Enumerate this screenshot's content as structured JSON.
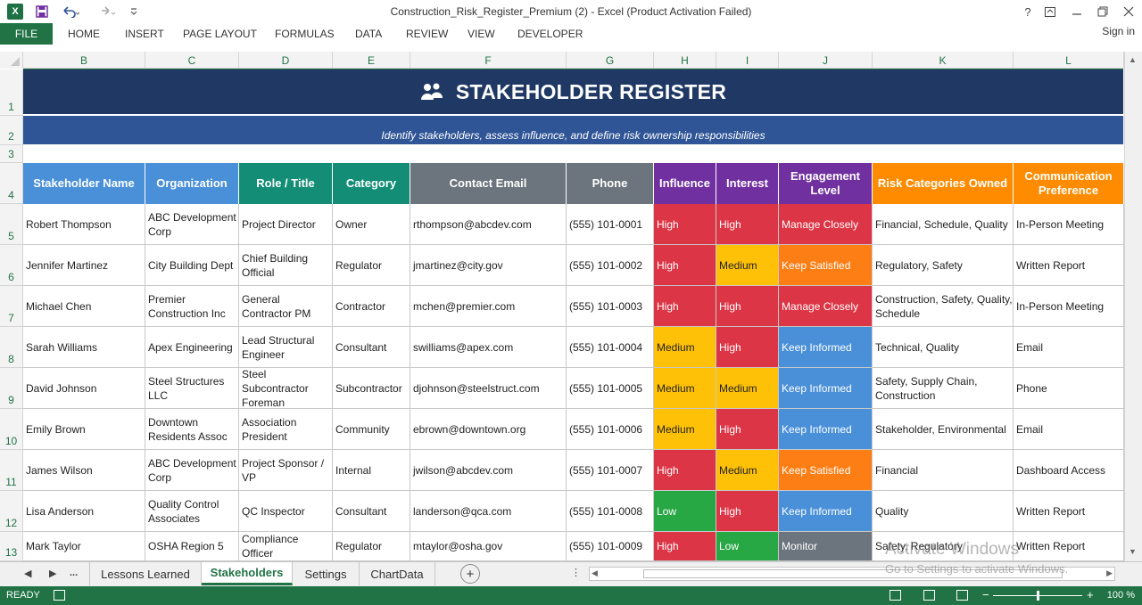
{
  "window": {
    "title": "Construction_Risk_Register_Premium (2) - Excel (Product Activation Failed)",
    "help": "?",
    "sign_in": "Sign in"
  },
  "ribbon": {
    "file": "FILE",
    "tabs": [
      "HOME",
      "INSERT",
      "PAGE LAYOUT",
      "FORMULAS",
      "DATA",
      "REVIEW",
      "VIEW",
      "DEVELOPER"
    ]
  },
  "columns": [
    "B",
    "C",
    "D",
    "E",
    "F",
    "G",
    "H",
    "I",
    "J",
    "K",
    "L"
  ],
  "rows": [
    "1",
    "2",
    "3",
    "4",
    "5",
    "6",
    "7",
    "8",
    "9",
    "10",
    "11",
    "12",
    "13"
  ],
  "banner": {
    "title": "STAKEHOLDER REGISTER",
    "subtitle": "Identify stakeholders, assess influence, and define risk ownership responsibilities"
  },
  "table": {
    "headers": [
      "Stakeholder Name",
      "Organization",
      "Role / Title",
      "Category",
      "Contact Email",
      "Phone",
      "Influence",
      "Interest",
      "Engagement Level",
      "Risk Categories Owned",
      "Communication Preference"
    ],
    "rows": [
      [
        "Robert Thompson",
        "ABC Development Corp",
        "Project Director",
        "Owner",
        "rthompson@abcdev.com",
        "(555) 101-0001",
        "High",
        "High",
        "Manage Closely",
        "Financial, Schedule, Quality",
        "In-Person Meeting"
      ],
      [
        "Jennifer Martinez",
        "City Building Dept",
        "Chief Building Official",
        "Regulator",
        "jmartinez@city.gov",
        "(555) 101-0002",
        "High",
        "Medium",
        "Keep Satisfied",
        "Regulatory, Safety",
        "Written Report"
      ],
      [
        "Michael Chen",
        "Premier Construction Inc",
        "General Contractor PM",
        "Contractor",
        "mchen@premier.com",
        "(555) 101-0003",
        "High",
        "High",
        "Manage Closely",
        "Construction, Safety, Quality, Schedule",
        "In-Person Meeting"
      ],
      [
        "Sarah Williams",
        "Apex Engineering",
        "Lead Structural Engineer",
        "Consultant",
        "swilliams@apex.com",
        "(555) 101-0004",
        "Medium",
        "High",
        "Keep Informed",
        "Technical, Quality",
        "Email"
      ],
      [
        "David Johnson",
        "Steel Structures LLC",
        "Steel Subcontractor Foreman",
        "Subcontractor",
        "djohnson@steelstruct.com",
        "(555) 101-0005",
        "Medium",
        "Medium",
        "Keep Informed",
        "Safety, Supply Chain, Construction",
        "Phone"
      ],
      [
        "Emily Brown",
        "Downtown Residents Assoc",
        "Association President",
        "Community",
        "ebrown@downtown.org",
        "(555) 101-0006",
        "Medium",
        "High",
        "Keep Informed",
        "Stakeholder, Environmental",
        "Email"
      ],
      [
        "James Wilson",
        "ABC Development Corp",
        "Project Sponsor / VP",
        "Internal",
        "jwilson@abcdev.com",
        "(555) 101-0007",
        "High",
        "Medium",
        "Keep Satisfied",
        "Financial",
        "Dashboard Access"
      ],
      [
        "Lisa Anderson",
        "Quality Control Associates",
        "QC Inspector",
        "Consultant",
        "landerson@qca.com",
        "(555) 101-0008",
        "Low",
        "High",
        "Keep Informed",
        "Quality",
        "Written Report"
      ],
      [
        "Mark Taylor",
        "OSHA Region 5",
        "Compliance Officer",
        "Regulator",
        "mtaylor@osha.gov",
        "(555) 101-0009",
        "High",
        "Low",
        "Monitor",
        "Safety, Regulatory",
        "Written Report"
      ]
    ]
  },
  "colors": {
    "excel_green": "#217346",
    "banner": "#1f3864",
    "subtitle": "#2f5597",
    "header_blue": "#4a90d9",
    "header_teal": "#138d75",
    "header_gray": "#6c757d",
    "header_purple": "#7030a0",
    "header_orange": "#ff8c00",
    "rating_high": "#dc3545",
    "rating_medium": "#ffc107",
    "rating_low": "#28a745",
    "eng_manage": "#dc3545",
    "eng_satisfied": "#fd7e14",
    "eng_informed": "#4a90d9",
    "eng_monitor": "#6c757d"
  },
  "sheets": {
    "more": "...",
    "tabs": [
      "Lessons Learned",
      "Stakeholders",
      "Settings",
      "ChartData"
    ],
    "active": "Stakeholders",
    "add": "+"
  },
  "status": {
    "ready": "READY",
    "zoom": "100 %",
    "zoom_minus": "−",
    "zoom_plus": "+"
  },
  "watermark": {
    "line1": "Activate Windows",
    "line2": "Go to Settings to activate Windows."
  }
}
